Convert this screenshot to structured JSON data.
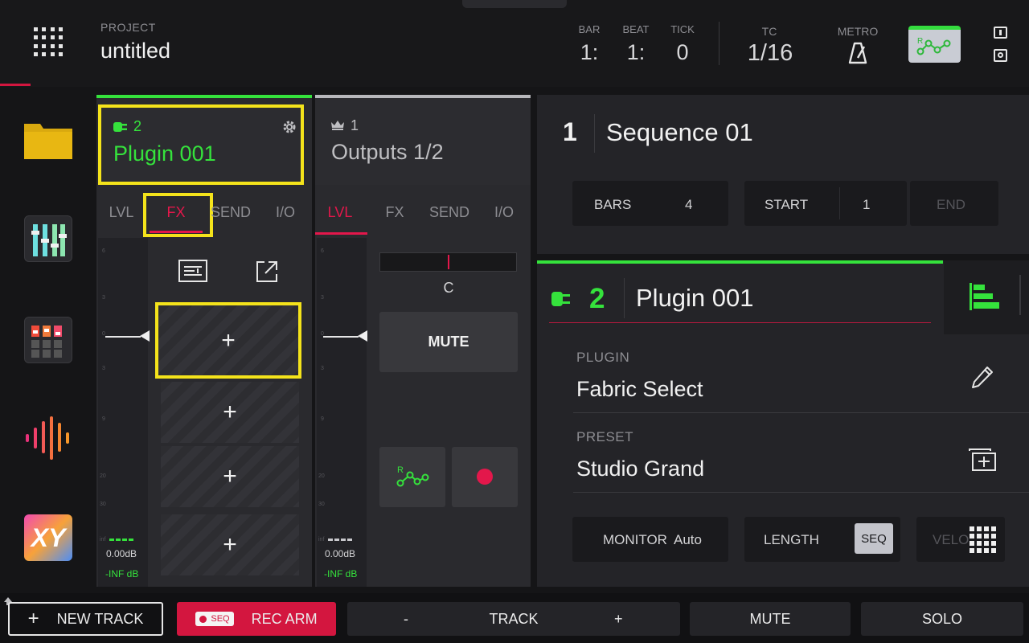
{
  "header": {
    "project_label": "PROJECT",
    "project_name": "untitled",
    "bar_label": "BAR",
    "bar_value": "1:",
    "beat_label": "BEAT",
    "beat_value": "1:",
    "tick_label": "TICK",
    "tick_value": "0",
    "tc_label": "TC",
    "tc_value": "1/16",
    "metro_label": "METRO",
    "auto_badge": "R"
  },
  "sidebar": {
    "items": [
      "browser-folder-icon",
      "mixer-icon",
      "pad-mixer-icon",
      "waveform-icon",
      "xy-fx-icon"
    ],
    "xy_text": "XY"
  },
  "strip1": {
    "number": "2",
    "name": "Plugin 001",
    "tabs": [
      "LVL",
      "FX",
      "SEND",
      "I/O"
    ],
    "active_tab": "FX",
    "meter_ticks": [
      "6",
      "3",
      "0",
      "3",
      "9",
      "20",
      "30",
      "inf"
    ],
    "level_db": "0.00dB",
    "peak_db": "-INF dB",
    "fx_slots": [
      "+",
      "+",
      "+",
      "+"
    ]
  },
  "strip2": {
    "number": "1",
    "name": "Outputs 1/2",
    "tabs": [
      "LVL",
      "FX",
      "SEND",
      "I/O"
    ],
    "active_tab": "LVL",
    "meter_ticks": [
      "6",
      "3",
      "0",
      "3",
      "9",
      "20",
      "30",
      "inf"
    ],
    "level_db": "0.00dB",
    "peak_db": "-INF dB",
    "pan_value": "C",
    "mute_label": "MUTE",
    "auto_badge": "R"
  },
  "sequence": {
    "number": "1",
    "name": "Sequence 01",
    "bars_label": "BARS",
    "bars_value": "4",
    "start_label": "START",
    "start_value": "1",
    "end_label": "END"
  },
  "track": {
    "number": "2",
    "name": "Plugin 001",
    "plugin_label": "PLUGIN",
    "plugin_value": "Fabric Select",
    "preset_label": "PRESET",
    "preset_value": "Studio Grand",
    "monitor_label": "MONITOR",
    "monitor_value": "Auto",
    "length_label": "LENGTH",
    "length_value": "SEQ",
    "velo_label": "VELO"
  },
  "bottom": {
    "new_track": "NEW TRACK",
    "seq_badge": "SEQ",
    "rec_arm": "REC ARM",
    "track_minus": "-",
    "track_label": "TRACK",
    "track_plus": "+",
    "mute": "MUTE",
    "solo": "SOLO"
  },
  "colors": {
    "accent_green": "#35e23c",
    "accent_red": "#e3174b",
    "highlight": "#f4e31b"
  }
}
